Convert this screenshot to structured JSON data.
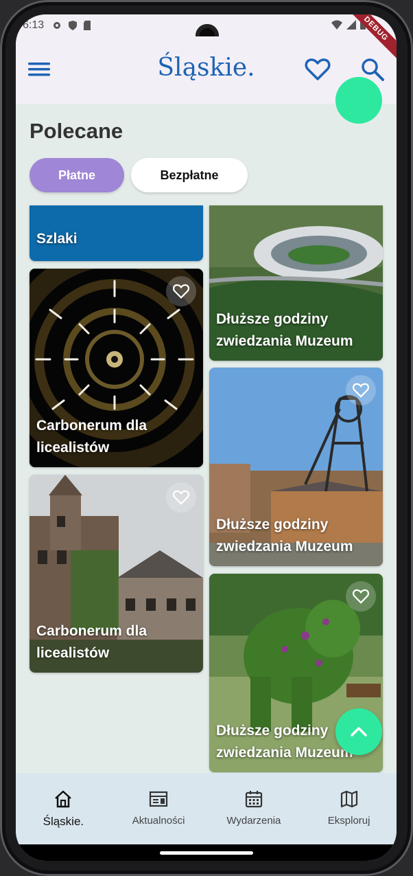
{
  "status_bar": {
    "time": "6:13",
    "debug_label": "DEBUG"
  },
  "header": {
    "logo_text": "Śląskie."
  },
  "section": {
    "title": "Polecane"
  },
  "filters": {
    "paid": "Płatne",
    "free": "Bezpłatne",
    "selected": "Płatne"
  },
  "cards_left": [
    {
      "title": "Szlaki",
      "type": "category",
      "color": "#0d6aab"
    },
    {
      "title": "Carbonerum dla licealistów",
      "favorite": false
    },
    {
      "title": "Carbonerum dla licealistów",
      "favorite": false
    }
  ],
  "cards_right": [
    {
      "title": "Dłuższe godziny zwiedzania Muzeum",
      "favorite": false
    },
    {
      "title": "Dłuższe godziny zwiedzania Muzeum",
      "favorite": false
    },
    {
      "title": "Dłuższe godziny zwiedzania Muzeum",
      "favorite": false
    }
  ],
  "bottom_nav": {
    "items": [
      {
        "label": "Śląskie.",
        "icon": "home-icon",
        "active": true
      },
      {
        "label": "Aktualności",
        "icon": "news-icon",
        "active": false
      },
      {
        "label": "Wydarzenia",
        "icon": "calendar-icon",
        "active": false
      },
      {
        "label": "Eksploruj",
        "icon": "map-icon",
        "active": false
      }
    ]
  },
  "colors": {
    "accent_teal": "#2ee8a0",
    "brand_blue": "#1e64b4",
    "chip_selected": "#9f86d6",
    "background": "#e4ecea"
  }
}
